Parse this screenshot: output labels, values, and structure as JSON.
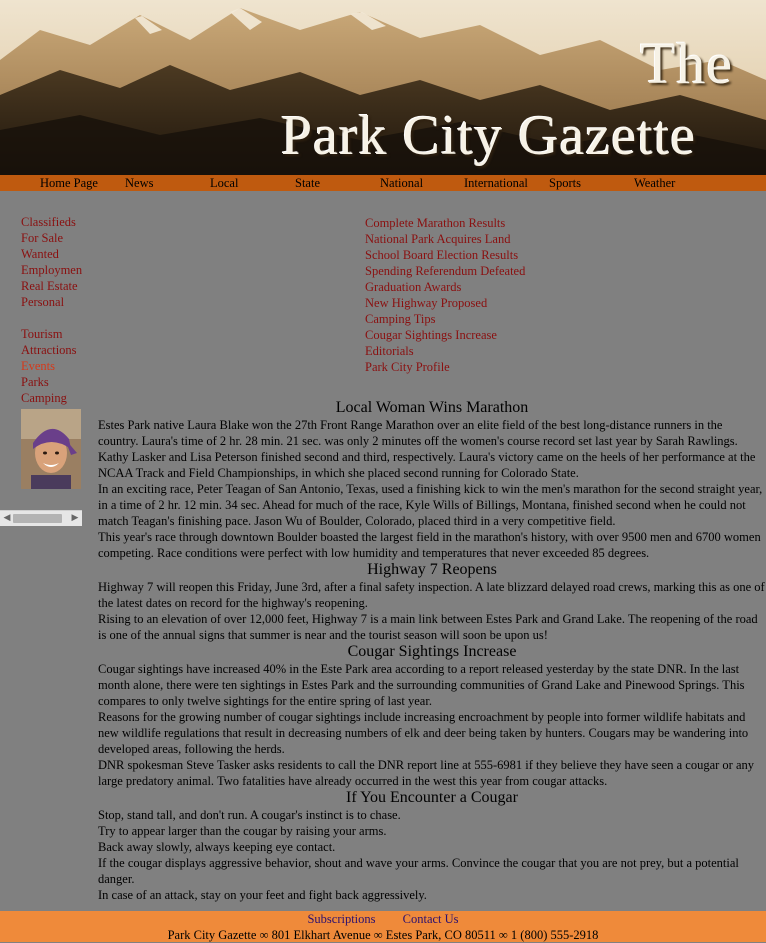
{
  "banner": {
    "title_the": "The",
    "title_main": "Park City Gazette"
  },
  "topnav": [
    "Home Page",
    "News",
    "Local",
    "State",
    "National",
    "International",
    "Sports",
    "Weather"
  ],
  "sidebar": {
    "group1": [
      "Classifieds",
      "For Sale",
      "Wanted",
      "Employment",
      "Real Estate",
      "Personal"
    ],
    "group2": [
      "Tourism",
      "Attractions",
      "Events",
      "Parks",
      "Camping"
    ]
  },
  "headlines": [
    "Complete Marathon Results",
    "National Park Acquires Land",
    "School Board Election Results",
    "Spending Referendum Defeated",
    "Graduation Awards",
    "New Highway Proposed",
    "Camping Tips",
    "Cougar Sightings Increase",
    "Editorials",
    "Park City Profile"
  ],
  "articles": [
    {
      "title": "Local Woman Wins Marathon",
      "paragraphs": [
        "Estes Park native Laura Blake won the 27th Front Range Marathon over an elite field of the best long-distance runners in the country. Laura's time of 2 hr. 28 min. 21 sec. was only 2 minutes off the women's course record set last year by Sarah Rawlings. Kathy Lasker and Lisa Peterson finished second and third, respectively. Laura's victory came on the heels of her performance at the NCAA Track and Field Championships, in which she placed second running for Colorado State.",
        "In an exciting race, Peter Teagan of San Antonio, Texas, used a finishing kick to win the men's marathon for the second straight year, in a time of 2 hr. 12 min. 34 sec. Ahead for much of the race, Kyle Wills of Billings, Montana, finished second when he could not match Teagan's finishing pace. Jason Wu of Boulder, Colorado, placed third in a very competitive field.",
        "This year's race through downtown Boulder boasted the largest field in the marathon's history, with over 9500 men and 6700 women competing. Race conditions were perfect with low humidity and temperatures that never exceeded 85 degrees."
      ]
    },
    {
      "title": "Highway 7 Reopens",
      "paragraphs": [
        "Highway 7 will reopen this Friday, June 3rd, after a final safety inspection. A late blizzard delayed road crews, marking this as one of the latest dates on record for the highway's reopening.",
        "Rising to an elevation of over 12,000 feet, Highway 7 is a main link between Estes Park and Grand Lake. The reopening of the road is one of the annual signs that summer is near and the tourist season will soon be upon us!"
      ]
    },
    {
      "title": "Cougar Sightings Increase",
      "paragraphs": [
        "Cougar sightings have increased 40% in the Este Park area according to a report released yesterday by the state DNR. In the last month alone, there were ten sightings in Estes Park and the surrounding communities of Grand Lake and Pinewood Springs. This compares to only twelve sightings for the entire spring of last year.",
        "Reasons for the growing number of cougar sightings include increasing encroachment by people into former wildlife habitats and new wildlife regulations that result in decreasing numbers of elk and deer being taken by hunters. Cougars may be wandering into developed areas, following the herds.",
        "DNR spokesman Steve Tasker asks residents to call the DNR report line at 555-6981 if they believe they have seen a cougar or any large predatory animal. Two fatalities have already occurred in the west this year from cougar attacks."
      ]
    },
    {
      "title": "If You Encounter a Cougar",
      "paragraphs": [
        "Stop, stand tall, and don't run. A cougar's instinct is to chase.",
        "Try to appear larger than the cougar by raising your arms.",
        "Back away slowly, always keeping eye contact.",
        "If the cougar displays aggressive behavior, shout and wave your arms. Convince the cougar that you are not prey, but a potential danger.",
        "In case of an attack, stay on your feet and fight back aggressively."
      ]
    }
  ],
  "footer": {
    "subscriptions": "Subscriptions",
    "contact": "Contact Us",
    "address": "Park City Gazette ∞ 801 Elkhart Avenue ∞ Estes Park, CO 80511 ∞ 1 (800) 555-2918"
  },
  "colors": {
    "page_bg": "#808080",
    "nav_bar": "#bf5a0f",
    "footer_bar": "#ef8a3a",
    "link_red": "#8a1010",
    "footer_link": "#2a1070"
  }
}
